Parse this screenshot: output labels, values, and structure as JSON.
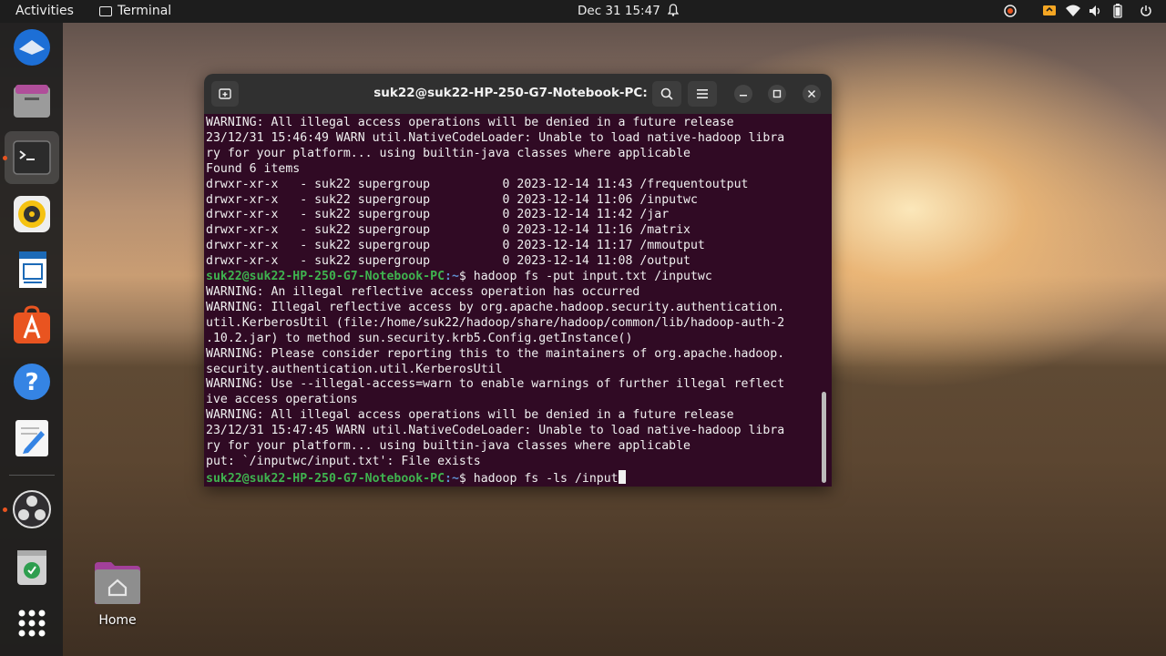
{
  "topbar": {
    "activities": "Activities",
    "app_name": "Terminal",
    "clock": "Dec 31  15:47"
  },
  "desktop": {
    "home_label": "Home"
  },
  "terminal": {
    "title": "suk22@suk22-HP-250-G7-Notebook-PC: ~",
    "lines": [
      {
        "text": "WARNING: All illegal access operations will be denied in a future release"
      },
      {
        "text": "23/12/31 15:46:49 WARN util.NativeCodeLoader: Unable to load native-hadoop libra"
      },
      {
        "text": "ry for your platform... using builtin-java classes where applicable"
      },
      {
        "text": "Found 6 items"
      },
      {
        "text": "drwxr-xr-x   - suk22 supergroup          0 2023-12-14 11:43 /frequentoutput"
      },
      {
        "text": "drwxr-xr-x   - suk22 supergroup          0 2023-12-14 11:06 /inputwc"
      },
      {
        "text": "drwxr-xr-x   - suk22 supergroup          0 2023-12-14 11:42 /jar"
      },
      {
        "text": "drwxr-xr-x   - suk22 supergroup          0 2023-12-14 11:16 /matrix"
      },
      {
        "text": "drwxr-xr-x   - suk22 supergroup          0 2023-12-14 11:17 /mmoutput"
      },
      {
        "text": "drwxr-xr-x   - suk22 supergroup          0 2023-12-14 11:08 /output"
      },
      {
        "prompt_user": "suk22@suk22-HP-250-G7-Notebook-PC",
        "prompt_path": ":~",
        "text": "$ hadoop fs -put input.txt /inputwc"
      },
      {
        "text": "WARNING: An illegal reflective access operation has occurred"
      },
      {
        "text": "WARNING: Illegal reflective access by org.apache.hadoop.security.authentication."
      },
      {
        "text": "util.KerberosUtil (file:/home/suk22/hadoop/share/hadoop/common/lib/hadoop-auth-2"
      },
      {
        "text": ".10.2.jar) to method sun.security.krb5.Config.getInstance()"
      },
      {
        "text": "WARNING: Please consider reporting this to the maintainers of org.apache.hadoop."
      },
      {
        "text": "security.authentication.util.KerberosUtil"
      },
      {
        "text": "WARNING: Use --illegal-access=warn to enable warnings of further illegal reflect"
      },
      {
        "text": "ive access operations"
      },
      {
        "text": "WARNING: All illegal access operations will be denied in a future release"
      },
      {
        "text": "23/12/31 15:47:45 WARN util.NativeCodeLoader: Unable to load native-hadoop libra"
      },
      {
        "text": "ry for your platform... using builtin-java classes where applicable"
      },
      {
        "text": "put: `/inputwc/input.txt': File exists"
      },
      {
        "prompt_user": "suk22@suk22-HP-250-G7-Notebook-PC",
        "prompt_path": ":~",
        "text": "$ hadoop fs -ls /input",
        "cursor": true
      }
    ]
  },
  "colors": {
    "terminal_bg": "#300a24",
    "prompt_user": "#3fb34f",
    "prompt_path": "#5f8fd1",
    "ubuntu_orange": "#e95420"
  }
}
